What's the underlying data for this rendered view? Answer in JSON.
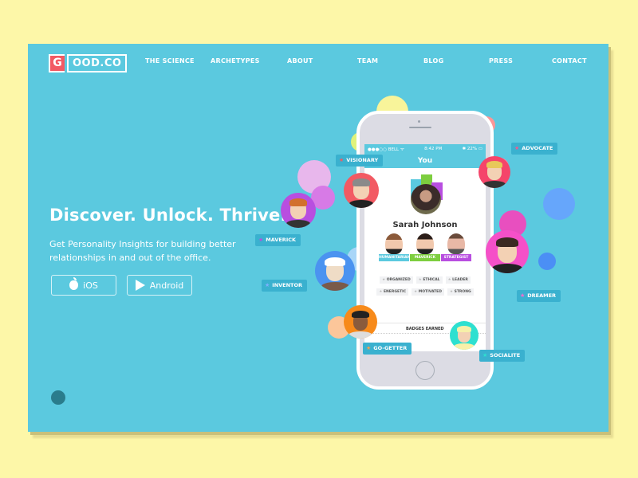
{
  "logo": {
    "mark": "G",
    "text": "OOD.CO"
  },
  "nav": [
    {
      "label": "THE SCIENCE"
    },
    {
      "label": "ARCHETYPES"
    },
    {
      "label": "ABOUT"
    },
    {
      "label": "TEAM"
    },
    {
      "label": "BLOG"
    },
    {
      "label": "PRESS"
    },
    {
      "label": "CONTACT"
    }
  ],
  "hero": {
    "title": "Discover. Unlock. Thrive.",
    "subtitle": "Get Personality Insights for building better relationships in and out of the office.",
    "buttons": [
      {
        "label": "iOS",
        "icon": "apple-icon"
      },
      {
        "label": "Android",
        "icon": "play-icon"
      }
    ]
  },
  "phone": {
    "status": {
      "carrier": "●●●○○ BELL ᯤ",
      "time": "8:42 PM",
      "battery": "✱ 22% ▭"
    },
    "title": "You",
    "profile_name": "Sarah Johnson",
    "archetypes": [
      {
        "label": "HUMANITARIAN",
        "color": "#5bc9df"
      },
      {
        "label": "MAVERICK",
        "color": "#7dce3f"
      },
      {
        "label": "STRATEGIST",
        "color": "#b84ee0"
      }
    ],
    "traits": [
      "ORGANIZED",
      "ETHICAL",
      "LEADER",
      "ENERGETIC",
      "MOTIVATED",
      "STRONG"
    ],
    "badges_label": "BADGES EARNED"
  },
  "tags": [
    {
      "label": "VISIONARY",
      "star_color": "#f25a63"
    },
    {
      "label": "ADVOCATE",
      "star_color": "#f25a90"
    },
    {
      "label": "MAVERICK",
      "star_color": "#b84ee0"
    },
    {
      "label": "INVENTOR",
      "star_color": "#7fb0ff"
    },
    {
      "label": "DREAMER",
      "star_color": "#ff6ad0"
    },
    {
      "label": "GO-GETTER",
      "star_color": "#f6a04d"
    },
    {
      "label": "SOCIALITE",
      "star_color": "#2ee0d0"
    }
  ],
  "colors": {
    "page_bg": "#fdf7a8",
    "hero_bg": "#5bc9df",
    "brand_red": "#f25a63",
    "tag_bg": "#3ab1cf"
  }
}
